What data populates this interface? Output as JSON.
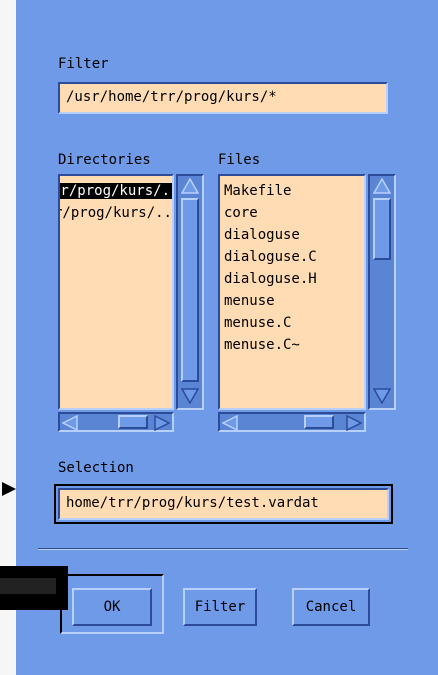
{
  "filter": {
    "label": "Filter",
    "value": "/usr/home/trr/prog/kurs/*"
  },
  "directories": {
    "label": "Directories",
    "items": [
      {
        "text": "/usr/home/trr/prog/kurs/.",
        "selected": true
      },
      {
        "text": "/usr/home/trr/prog/kurs/..",
        "selected": false
      }
    ]
  },
  "files": {
    "label": "Files",
    "items": [
      "Makefile",
      "core",
      "dialoguse",
      "dialoguse.C",
      "dialoguse.H",
      "menuse",
      "menuse.C",
      "menuse.C~"
    ]
  },
  "selection": {
    "label": "Selection",
    "value": "home/trr/prog/kurs/test.vardat"
  },
  "buttons": {
    "ok": "OK",
    "filter": "Filter",
    "cancel": "Cancel"
  },
  "colors": {
    "dialog_bg": "#6e9ae8",
    "field_bg": "#ffdcb4",
    "shadow": "#2c4c9a",
    "highlight": "#b8d0ff"
  }
}
